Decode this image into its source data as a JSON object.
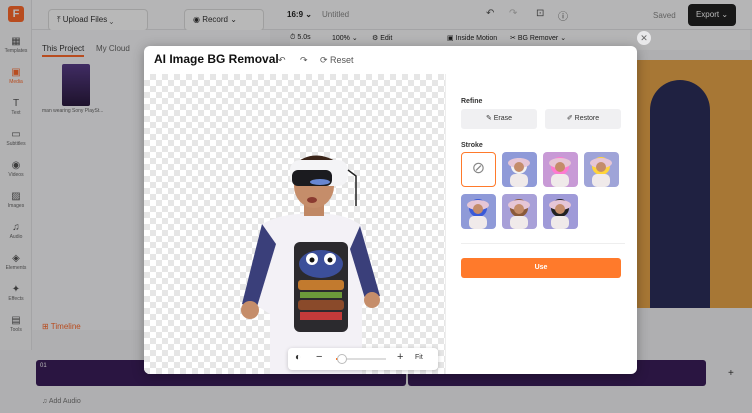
{
  "rail": {
    "items": [
      {
        "label": "Templates",
        "icon": "templates-icon",
        "glyph": "▦"
      },
      {
        "label": "Media",
        "icon": "media-icon",
        "glyph": "▣"
      },
      {
        "label": "Text",
        "icon": "text-icon",
        "glyph": "T"
      },
      {
        "label": "Subtitles",
        "icon": "subtitles-icon",
        "glyph": "▭"
      },
      {
        "label": "Videos",
        "icon": "videos-icon",
        "glyph": "◉"
      },
      {
        "label": "Images",
        "icon": "images-icon",
        "glyph": "▨"
      },
      {
        "label": "Audio",
        "icon": "audio-icon",
        "glyph": "♫"
      },
      {
        "label": "Elements",
        "icon": "elements-icon",
        "glyph": "◈"
      },
      {
        "label": "Effects",
        "icon": "effects-icon",
        "glyph": "✦"
      },
      {
        "label": "Tools",
        "icon": "tools-icon",
        "glyph": "▤"
      }
    ]
  },
  "topbar": {
    "upload": "Upload Files",
    "record": "Record",
    "ratio": "16:9",
    "project": "Untitled",
    "saved": "Saved",
    "export": "Export"
  },
  "panel": {
    "tab_project": "This Project",
    "tab_cloud": "My Cloud",
    "file_name": "man wearing Sony PlaySt..."
  },
  "toolbar2": {
    "duration": "5.0s",
    "zoom": "100%",
    "edit": "Edit",
    "inside_motion": "Inside Motion",
    "bg_remover": "BG Remover"
  },
  "timeline": {
    "label": "Timeline",
    "clip_index": "01",
    "add_audio": "Add Audio"
  },
  "modal": {
    "title": "AI Image BG Removal",
    "reset": "Reset",
    "refine_label": "Refine",
    "erase": "Erase",
    "restore": "Restore",
    "stroke_label": "Stroke",
    "use": "Use",
    "fit": "Fit",
    "zoom_level": 0.12
  },
  "colors": {
    "accent": "#ff7a2b",
    "brand": "#ff6a2b"
  }
}
